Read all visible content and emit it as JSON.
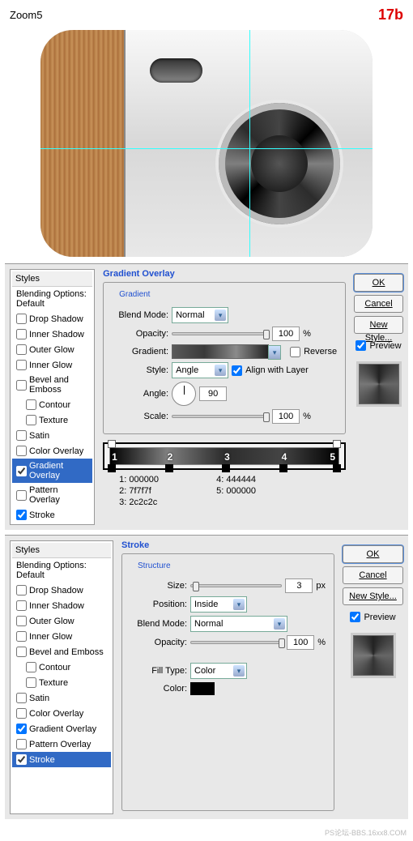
{
  "header": {
    "title": "Zoom5",
    "step": "17b"
  },
  "styles_panel": {
    "title": "Styles",
    "blending_opts": "Blending Options: Default",
    "effects": {
      "drop_shadow": "Drop Shadow",
      "inner_shadow": "Inner Shadow",
      "outer_glow": "Outer Glow",
      "inner_glow": "Inner Glow",
      "bevel": "Bevel and Emboss",
      "contour": "Contour",
      "texture": "Texture",
      "satin": "Satin",
      "color_ov": "Color Overlay",
      "grad_ov": "Gradient Overlay",
      "pat_ov": "Pattern Overlay",
      "stroke": "Stroke"
    }
  },
  "gradient_overlay": {
    "legend": "Gradient Overlay",
    "sub": "Gradient",
    "blend_mode_lbl": "Blend Mode:",
    "blend_mode": "Normal",
    "opacity_lbl": "Opacity:",
    "opacity": "100",
    "pct": "%",
    "gradient_lbl": "Gradient:",
    "reverse": "Reverse",
    "style_lbl": "Style:",
    "style": "Angle",
    "align": "Align with Layer",
    "angle_lbl": "Angle:",
    "angle": "90",
    "scale_lbl": "Scale:",
    "scale": "100"
  },
  "grad_stops": {
    "s1": "1: 000000",
    "s2": "2: 7f7f7f",
    "s3": "3: 2c2c2c",
    "s4": "4: 444444",
    "s5": "5: 000000"
  },
  "stroke": {
    "legend": "Stroke",
    "sub": "Structure",
    "size_lbl": "Size:",
    "size": "3",
    "px": "px",
    "position_lbl": "Position:",
    "position": "Inside",
    "blend_mode_lbl": "Blend Mode:",
    "blend_mode": "Normal",
    "opacity_lbl": "Opacity:",
    "opacity": "100",
    "pct": "%",
    "filltype_lbl": "Fill Type:",
    "filltype": "Color",
    "color_lbl": "Color:"
  },
  "buttons": {
    "ok": "OK",
    "cancel": "Cancel",
    "newstyle": "New Style...",
    "preview": "Preview"
  },
  "watermark": "PS论坛-BBS.16xx8.COM"
}
